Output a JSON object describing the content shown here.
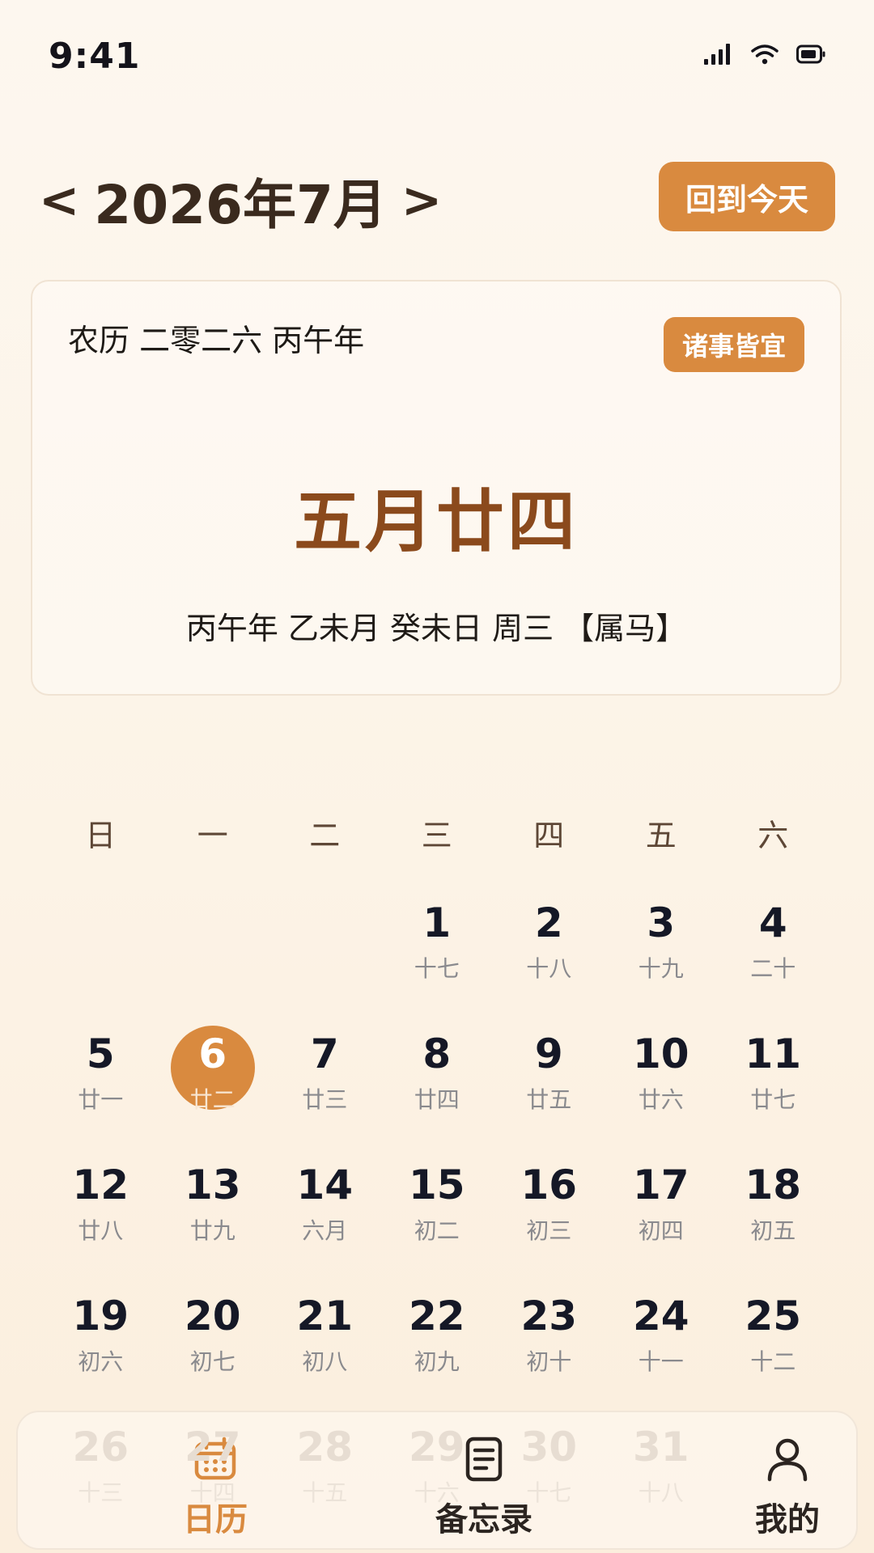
{
  "status_bar": {
    "time": "9:41",
    "icons": [
      "signal-icon",
      "wifi-icon",
      "battery-icon"
    ]
  },
  "header": {
    "prev_arrow": "<",
    "month_title": "2026年7月",
    "next_arrow": ">",
    "today_button": "回到今天"
  },
  "lunar_card": {
    "lunar_year": "农历 二零二六 丙午年",
    "badge": "诸事皆宜",
    "lunar_date": "五月廿四",
    "ganzhi": "丙午年 乙未月 癸未日 周三 【属马】"
  },
  "weekdays": [
    "日",
    "一",
    "二",
    "三",
    "四",
    "五",
    "六"
  ],
  "calendar": {
    "today": "6",
    "rows": [
      [
        {
          "d": "",
          "l": ""
        },
        {
          "d": "",
          "l": ""
        },
        {
          "d": "",
          "l": ""
        },
        {
          "d": "1",
          "l": "十七"
        },
        {
          "d": "2",
          "l": "十八"
        },
        {
          "d": "3",
          "l": "十九"
        },
        {
          "d": "4",
          "l": "二十"
        }
      ],
      [
        {
          "d": "5",
          "l": "廿一"
        },
        {
          "d": "6",
          "l": "廿二"
        },
        {
          "d": "7",
          "l": "廿三"
        },
        {
          "d": "8",
          "l": "廿四"
        },
        {
          "d": "9",
          "l": "廿五"
        },
        {
          "d": "10",
          "l": "廿六"
        },
        {
          "d": "11",
          "l": "廿七"
        }
      ],
      [
        {
          "d": "12",
          "l": "廿八"
        },
        {
          "d": "13",
          "l": "廿九"
        },
        {
          "d": "14",
          "l": "六月"
        },
        {
          "d": "15",
          "l": "初二"
        },
        {
          "d": "16",
          "l": "初三"
        },
        {
          "d": "17",
          "l": "初四"
        },
        {
          "d": "18",
          "l": "初五"
        }
      ],
      [
        {
          "d": "19",
          "l": "初六"
        },
        {
          "d": "20",
          "l": "初七"
        },
        {
          "d": "21",
          "l": "初八"
        },
        {
          "d": "22",
          "l": "初九"
        },
        {
          "d": "23",
          "l": "初十"
        },
        {
          "d": "24",
          "l": "十一"
        },
        {
          "d": "25",
          "l": "十二"
        }
      ],
      [
        {
          "d": "26",
          "l": "十三"
        },
        {
          "d": "27",
          "l": "十四"
        },
        {
          "d": "28",
          "l": "十五"
        },
        {
          "d": "29",
          "l": "十六"
        },
        {
          "d": "30",
          "l": "十七"
        },
        {
          "d": "31",
          "l": "十八"
        },
        {
          "d": "",
          "l": ""
        }
      ]
    ]
  },
  "tab_bar": {
    "calendar": "日历",
    "memo": "备忘录",
    "mine": "我的"
  },
  "colors": {
    "accent": "#d98a3f",
    "lunar_date": "#8b4a1c",
    "background": "#fdf7ef"
  }
}
